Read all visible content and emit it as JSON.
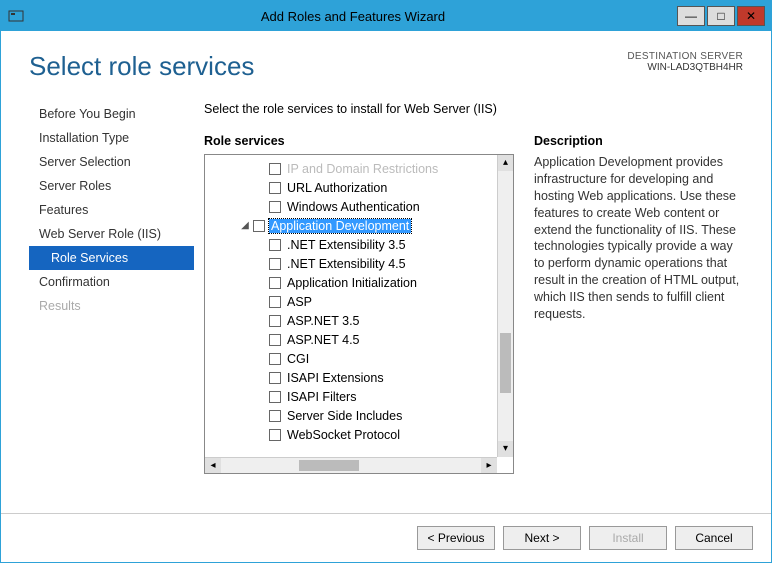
{
  "window": {
    "title": "Add Roles and Features Wizard"
  },
  "header": {
    "page_title": "Select role services",
    "destination_label": "DESTINATION SERVER",
    "destination_value": "WIN-LAD3QTBH4HR"
  },
  "sidebar": {
    "items": [
      {
        "label": "Before You Begin",
        "selected": false,
        "disabled": false
      },
      {
        "label": "Installation Type",
        "selected": false,
        "disabled": false
      },
      {
        "label": "Server Selection",
        "selected": false,
        "disabled": false
      },
      {
        "label": "Server Roles",
        "selected": false,
        "disabled": false
      },
      {
        "label": "Features",
        "selected": false,
        "disabled": false
      },
      {
        "label": "Web Server Role (IIS)",
        "selected": false,
        "disabled": false
      },
      {
        "label": "Role Services",
        "selected": true,
        "disabled": false
      },
      {
        "label": "Confirmation",
        "selected": false,
        "disabled": false
      },
      {
        "label": "Results",
        "selected": false,
        "disabled": true
      }
    ]
  },
  "panel": {
    "instruction": "Select the role services to install for Web Server (IIS)",
    "tree_label": "Role services",
    "desc_label": "Description",
    "desc_text": "Application Development provides infrastructure for developing and hosting Web applications. Use these features to create Web content or extend the functionality of IIS. These technologies typically provide a way to perform dynamic operations that result in the creation of HTML output, which IIS then sends to fulfill client requests."
  },
  "tree": [
    {
      "indent": 3,
      "label": "IP and Domain Restrictions",
      "checked": false,
      "selected": false,
      "faded": true
    },
    {
      "indent": 3,
      "label": "URL Authorization",
      "checked": false,
      "selected": false
    },
    {
      "indent": 3,
      "label": "Windows Authentication",
      "checked": false,
      "selected": false
    },
    {
      "indent": 2,
      "label": "Application Development",
      "checked": false,
      "selected": true,
      "expander": "⊿"
    },
    {
      "indent": 3,
      "label": ".NET Extensibility 3.5",
      "checked": false,
      "selected": false
    },
    {
      "indent": 3,
      "label": ".NET Extensibility 4.5",
      "checked": false,
      "selected": false
    },
    {
      "indent": 3,
      "label": "Application Initialization",
      "checked": false,
      "selected": false
    },
    {
      "indent": 3,
      "label": "ASP",
      "checked": false,
      "selected": false
    },
    {
      "indent": 3,
      "label": "ASP.NET 3.5",
      "checked": false,
      "selected": false
    },
    {
      "indent": 3,
      "label": "ASP.NET 4.5",
      "checked": false,
      "selected": false
    },
    {
      "indent": 3,
      "label": "CGI",
      "checked": false,
      "selected": false
    },
    {
      "indent": 3,
      "label": "ISAPI Extensions",
      "checked": false,
      "selected": false
    },
    {
      "indent": 3,
      "label": "ISAPI Filters",
      "checked": false,
      "selected": false
    },
    {
      "indent": 3,
      "label": "Server Side Includes",
      "checked": false,
      "selected": false
    },
    {
      "indent": 3,
      "label": "WebSocket Protocol",
      "checked": false,
      "selected": false
    }
  ],
  "footer": {
    "previous": "< Previous",
    "next": "Next >",
    "install": "Install",
    "cancel": "Cancel"
  }
}
